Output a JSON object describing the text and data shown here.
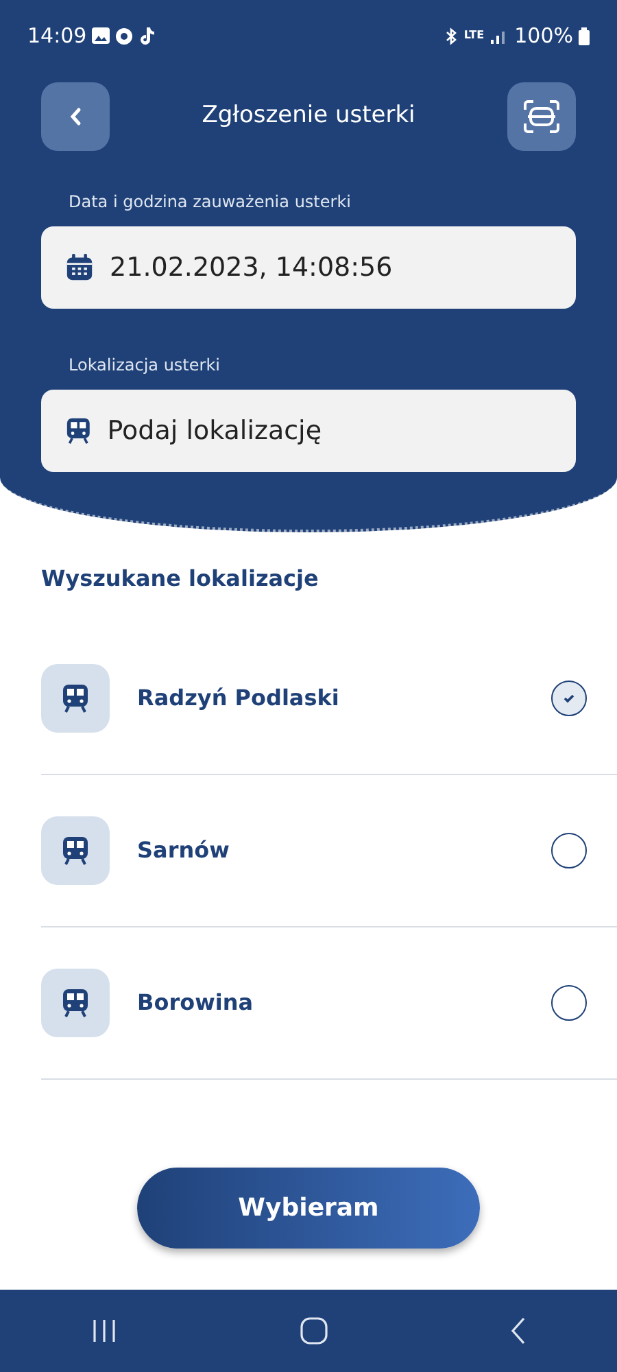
{
  "status_bar": {
    "time": "14:09",
    "network": "LTE",
    "battery": "100%"
  },
  "header": {
    "title": "Zgłoszenie usterki"
  },
  "fields": [
    {
      "kind": "date",
      "label": "Data i godzina zauważenia usterki",
      "value": "21.02.2023, 14:08:56"
    },
    {
      "kind": "location",
      "label": "Lokalizacja usterki",
      "placeholder": "Podaj lokalizację"
    }
  ],
  "results": {
    "title": "Wyszukane lokalizacje",
    "items": [
      {
        "name": "Radzyń Podlaski",
        "selected": true
      },
      {
        "name": "Sarnów",
        "selected": false
      },
      {
        "name": "Borowina",
        "selected": false
      }
    ]
  },
  "button": "Wybieram"
}
